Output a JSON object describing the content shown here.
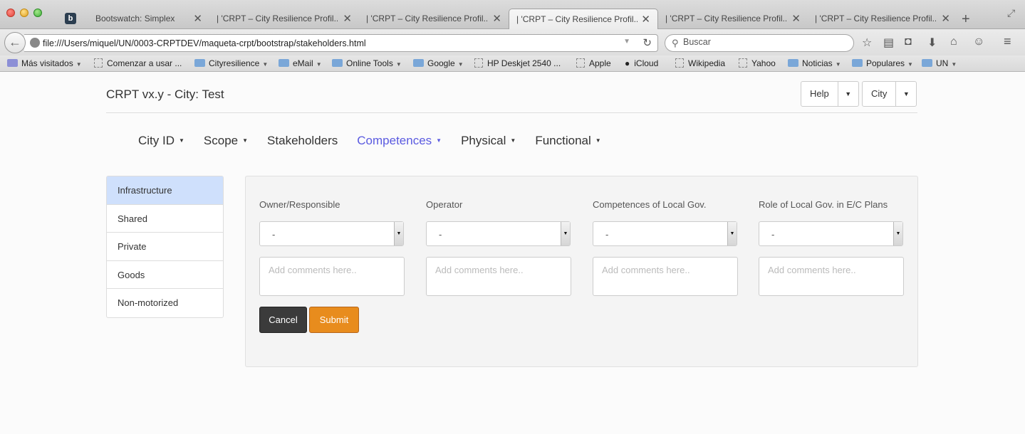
{
  "browser": {
    "tabs": [
      {
        "label": "Bootswatch: Simplex",
        "active": false
      },
      {
        "label": "| 'CRPT – City Resilience Profil...",
        "active": false
      },
      {
        "label": "| 'CRPT – City Resilience Profil...",
        "active": false
      },
      {
        "label": "| 'CRPT – City Resilience Profil...",
        "active": true
      },
      {
        "label": "| 'CRPT – City Resilience Profil...",
        "active": false
      },
      {
        "label": "| 'CRPT – City Resilience Profil...",
        "active": false
      }
    ],
    "url": "file:///Users/miquel/UN/0003-CRPTDEV/maqueta-crpt/bootstrap/stakeholders.html",
    "search_placeholder": "Buscar",
    "bookmarks": [
      {
        "label": "Más visitados",
        "kind": "special",
        "dropdown": true
      },
      {
        "label": "Comenzar a usar ...",
        "kind": "page",
        "dropdown": false
      },
      {
        "label": "Cityresilience",
        "kind": "folder",
        "dropdown": true
      },
      {
        "label": "eMail",
        "kind": "folder",
        "dropdown": true
      },
      {
        "label": "Online Tools",
        "kind": "folder",
        "dropdown": true
      },
      {
        "label": "Google",
        "kind": "folder",
        "dropdown": true
      },
      {
        "label": "HP Deskjet 2540 ...",
        "kind": "page",
        "dropdown": false
      },
      {
        "label": "Apple",
        "kind": "page",
        "dropdown": false
      },
      {
        "label": "iCloud",
        "kind": "apple",
        "dropdown": false
      },
      {
        "label": "Wikipedia",
        "kind": "page",
        "dropdown": false
      },
      {
        "label": "Yahoo",
        "kind": "page",
        "dropdown": false
      },
      {
        "label": "Noticias",
        "kind": "folder",
        "dropdown": true
      },
      {
        "label": "Populares",
        "kind": "folder",
        "dropdown": true
      },
      {
        "label": "UN",
        "kind": "folder",
        "dropdown": true
      }
    ]
  },
  "page": {
    "brand": "CRPT vx.y - City: Test",
    "help_label": "Help",
    "city_label": "City",
    "nav": [
      {
        "label": "City ID",
        "dropdown": true,
        "active": false
      },
      {
        "label": "Scope",
        "dropdown": true,
        "active": false
      },
      {
        "label": "Stakeholders",
        "dropdown": false,
        "active": false
      },
      {
        "label": "Competences",
        "dropdown": true,
        "active": true
      },
      {
        "label": "Physical",
        "dropdown": true,
        "active": false
      },
      {
        "label": "Functional",
        "dropdown": true,
        "active": false
      }
    ],
    "sidebar": [
      {
        "label": "Infrastructure",
        "active": true
      },
      {
        "label": "Shared",
        "active": false
      },
      {
        "label": "Private",
        "active": false
      },
      {
        "label": "Goods",
        "active": false
      },
      {
        "label": "Non-motorized",
        "active": false
      }
    ],
    "columns": [
      {
        "label": "Owner/Responsible",
        "select_value": "-",
        "comment_placeholder": "Add comments here.."
      },
      {
        "label": "Operator",
        "select_value": "-",
        "comment_placeholder": "Add comments here.."
      },
      {
        "label": "Competences of Local Gov.",
        "select_value": "-",
        "comment_placeholder": "Add comments here.."
      },
      {
        "label": "Role of Local Gov. in E/C Plans",
        "select_value": "-",
        "comment_placeholder": "Add comments here.."
      }
    ],
    "cancel_label": "Cancel",
    "submit_label": "Submit"
  },
  "colors": {
    "active_nav": "#5a5ae0",
    "sidebar_active": "#cfe0fc",
    "submit": "#e88c1d",
    "cancel": "#3b3b3b"
  }
}
